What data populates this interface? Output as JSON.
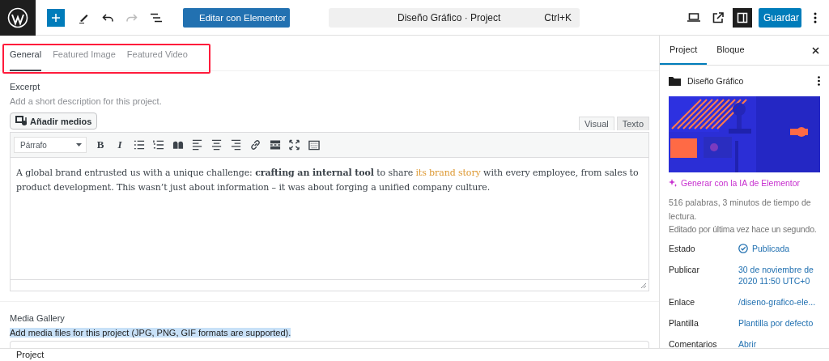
{
  "topbar": {
    "elementor_button": "Editar con Elementor",
    "command": {
      "title": "Diseño Gráfico · Project",
      "shortcut": "Ctrl+K"
    },
    "undo_disabled": false,
    "redo_disabled": true,
    "sidebar_toggle_on": true,
    "save_button": "Guardar"
  },
  "tabs": [
    {
      "label": "General",
      "selected": true
    },
    {
      "label": "Featured Image",
      "selected": false
    },
    {
      "label": "Featured Video",
      "selected": false
    }
  ],
  "excerpt": {
    "label": "Excerpt",
    "help": "Add a short description for this project.",
    "add_media_button": "Añadir medios",
    "modes": [
      {
        "label": "Visual",
        "selected": true
      },
      {
        "label": "Texto",
        "selected": false
      }
    ],
    "format_select": "Párrafo",
    "bold_button": "B",
    "italic_button": "I",
    "content": {
      "before": "A global brand entrusted us with a unique challenge: **crafting an internal tool** to share ",
      "link": "its brand story",
      "after": " with every employee, from sales to product development. This wasn’t just about information – it was about forging a unified company culture."
    }
  },
  "media_gallery": {
    "label": "Media Gallery",
    "help": "Add media files for this project (JPG, PNG, GIF formats are supported).",
    "help_selected": true
  },
  "sidebar": {
    "tabs": [
      {
        "label": "Project",
        "selected": true
      },
      {
        "label": "Bloque",
        "selected": false
      }
    ],
    "post_type_title": "Diseño Gráfico",
    "ai_link": "Generar con la IA de Elementor",
    "stats": "516 palabras, 3 minutos de tiempo de lectura.",
    "last_edited": "Editado por última vez hace un segundo.",
    "fields": [
      {
        "label": "Estado",
        "value": "Publicada",
        "kind": "status"
      },
      {
        "label": "Publicar",
        "value": "30 de noviembre de 2020 11:50 UTC+0",
        "kind": "link"
      },
      {
        "label": "Enlace",
        "value": "/diseno-grafico-ele...",
        "kind": "link"
      },
      {
        "label": "Plantilla",
        "value": "Plantilla por defecto",
        "kind": "link"
      },
      {
        "label": "Comentarios",
        "value": "Abrir",
        "kind": "link"
      }
    ]
  },
  "breadcrumb": "Project"
}
